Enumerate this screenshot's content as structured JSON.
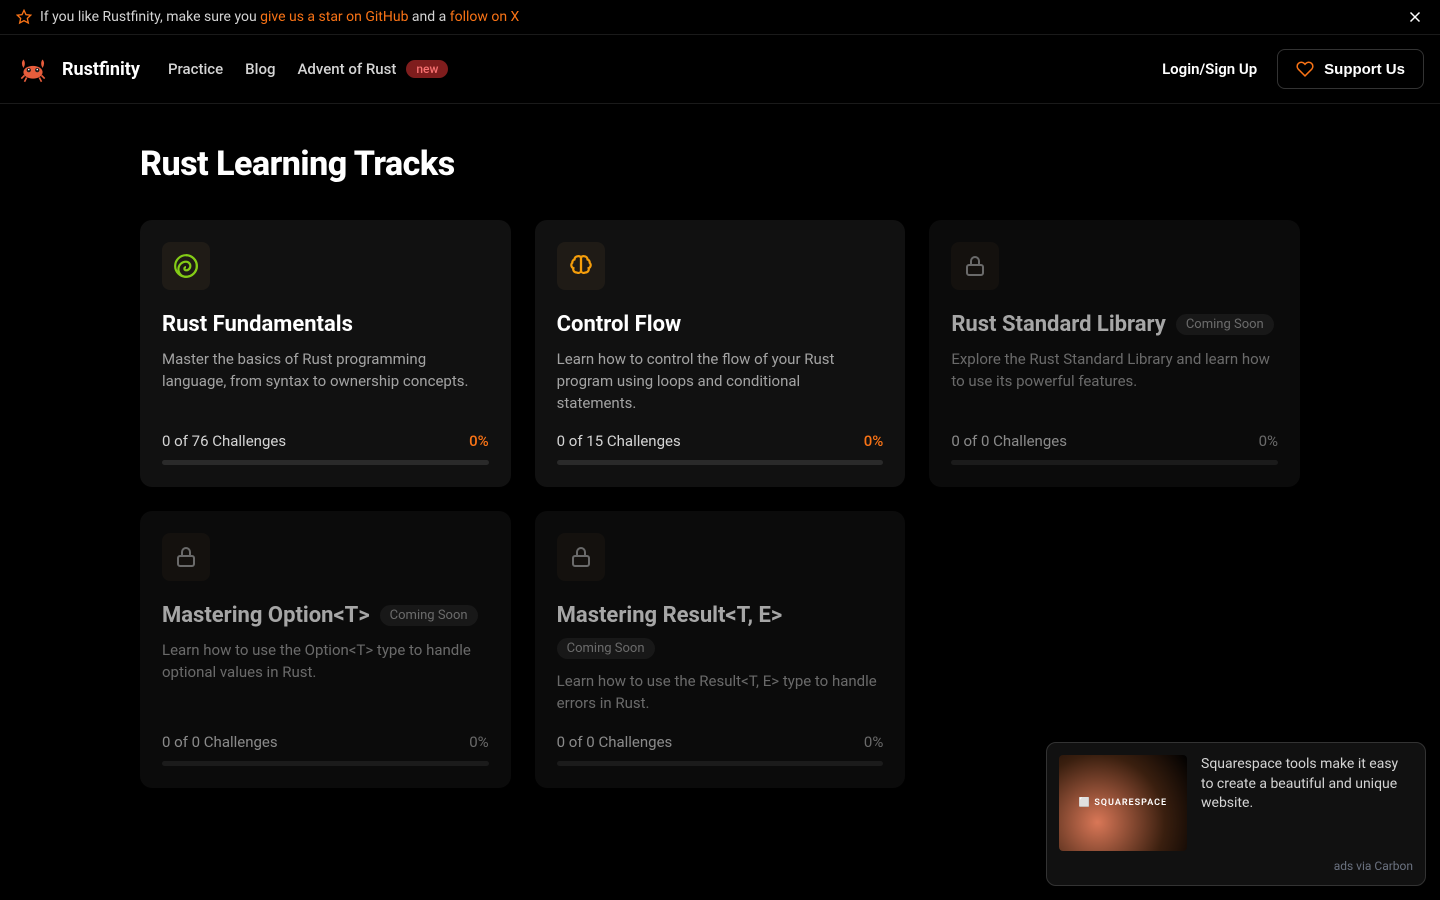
{
  "topbar": {
    "prefix": "If you like Rustfinity, make sure you ",
    "link1": "give us a star on GitHub",
    "mid": " and a ",
    "link2": "follow on X"
  },
  "brand": "Rustfinity",
  "nav": {
    "practice": "Practice",
    "blog": "Blog",
    "advent": "Advent of Rust",
    "new_badge": "new",
    "login": "Login/Sign Up",
    "support": "Support Us"
  },
  "page_title": "Rust Learning Tracks",
  "coming_soon_label": "Coming Soon",
  "tracks": [
    {
      "title": "Rust Fundamentals",
      "desc": "Master the basics of Rust programming language, from syntax to ownership concepts.",
      "progress_label": "0 of 76 Challenges",
      "pct": "0%",
      "locked": false,
      "icon": "spiral",
      "soon": false
    },
    {
      "title": "Control Flow",
      "desc": "Learn how to control the flow of your Rust program using loops and conditional statements.",
      "progress_label": "0 of 15 Challenges",
      "pct": "0%",
      "locked": false,
      "icon": "brain",
      "soon": false
    },
    {
      "title": "Rust Standard Library",
      "desc": "Explore the Rust Standard Library and learn how to use its powerful features.",
      "progress_label": "0 of 0 Challenges",
      "pct": "0%",
      "locked": true,
      "icon": "lock",
      "soon": true
    },
    {
      "title": "Mastering Option<T>",
      "desc": "Learn how to use the Option<T> type to handle optional values in Rust.",
      "progress_label": "0 of 0 Challenges",
      "pct": "0%",
      "locked": true,
      "icon": "lock",
      "soon": true
    },
    {
      "title": "Mastering Result<T, E>",
      "desc": "Learn how to use the Result<T, E> type to handle errors in Rust.",
      "progress_label": "0 of 0 Challenges",
      "pct": "0%",
      "locked": true,
      "icon": "lock",
      "soon": true
    }
  ],
  "ad": {
    "img_label": "⬜ SQUARESPACE",
    "text": "Squarespace tools make it easy to create a beautiful and unique website.",
    "via": "ads via Carbon"
  }
}
